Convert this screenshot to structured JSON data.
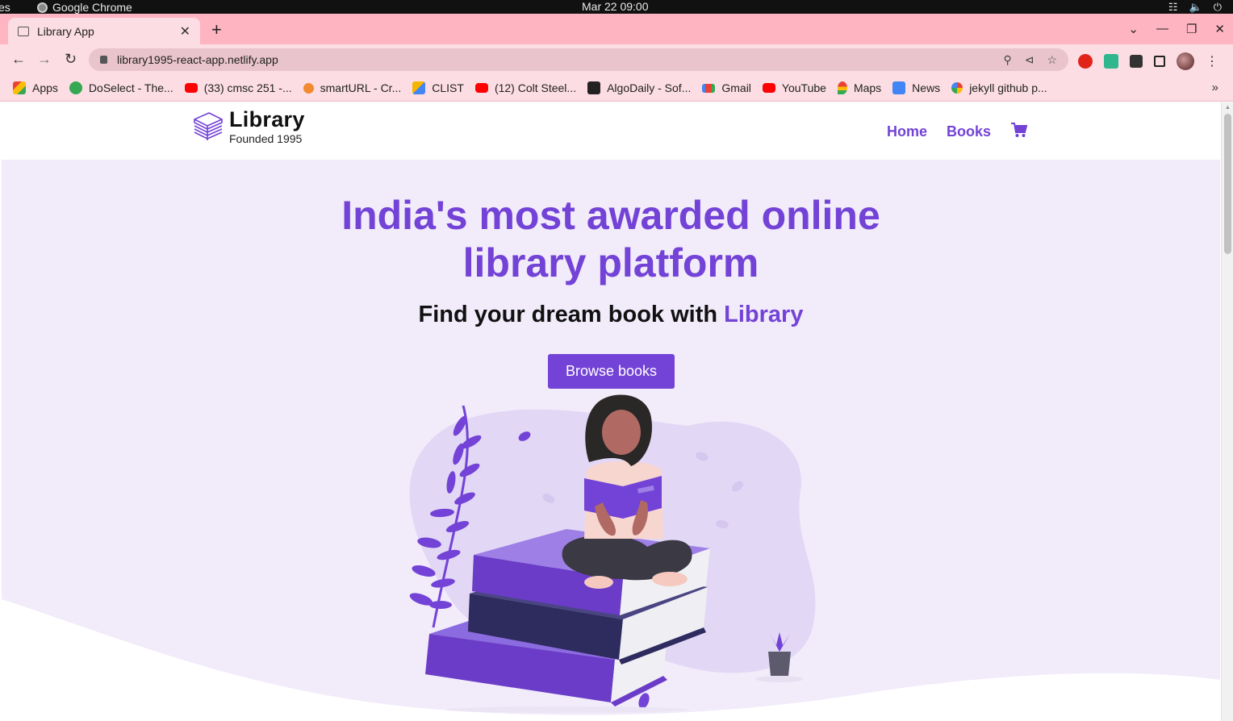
{
  "os": {
    "activities": "es",
    "app_name": "Google Chrome",
    "clock": "Mar 22  09:00"
  },
  "browser": {
    "tab_title": "Library App",
    "url": "library1995-react-app.netlify.app",
    "bookmarks": [
      {
        "label": "Apps",
        "icon": "apps-grid-icon",
        "color": "#4285f4"
      },
      {
        "label": "DoSelect - The...",
        "icon": "check-circle-icon",
        "color": "#34a853"
      },
      {
        "label": "(33) cmsc 251 -...",
        "icon": "youtube-icon",
        "color": "#ff0000"
      },
      {
        "label": "smartURL - Cr...",
        "icon": "smarturl-icon",
        "color": "#f28b30"
      },
      {
        "label": "CLIST",
        "icon": "clist-icon",
        "color": "#f5b400"
      },
      {
        "label": "(12) Colt Steel...",
        "icon": "youtube-icon",
        "color": "#ff0000"
      },
      {
        "label": "AlgoDaily - Sof...",
        "icon": "algodaily-icon",
        "color": "#222222"
      },
      {
        "label": "Gmail",
        "icon": "gmail-icon",
        "color": "#ea4335"
      },
      {
        "label": "YouTube",
        "icon": "youtube-icon",
        "color": "#ff0000"
      },
      {
        "label": "Maps",
        "icon": "maps-pin-icon",
        "color": "#34a853"
      },
      {
        "label": "News",
        "icon": "news-icon",
        "color": "#4285f4"
      },
      {
        "label": "jekyll github p...",
        "icon": "google-icon",
        "color": "#4285f4"
      }
    ],
    "more_bookmarks": "»"
  },
  "site": {
    "logo_title": "Library",
    "logo_subtitle": "Founded 1995",
    "nav": {
      "home": "Home",
      "books": "Books"
    },
    "hero_title_line1": "India's most awarded online",
    "hero_title_line2": "library platform",
    "hero_sub_prefix": "Find your dream book with ",
    "hero_sub_accent": "Library",
    "cta_label": "Browse books"
  },
  "colors": {
    "accent": "#7342d6",
    "hero_bg": "#f1ebfa",
    "tab_strip": "#ffb4c2",
    "toolbar": "#fbdde3"
  }
}
